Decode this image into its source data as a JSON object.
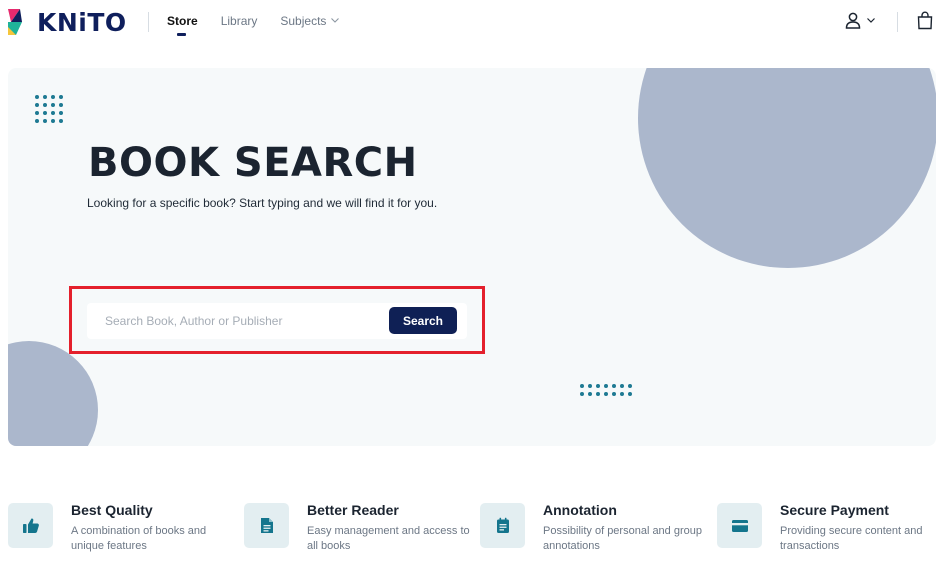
{
  "brand": {
    "name": "KNiTO",
    "colors": {
      "navy": "#0f1f5c",
      "teal": "#1e7a93",
      "pink": "#e62a6e",
      "yellow": "#f5c63b",
      "green": "#1fb39a"
    }
  },
  "nav": {
    "items": [
      {
        "label": "Store",
        "active": true
      },
      {
        "label": "Library",
        "active": false
      },
      {
        "label": "Subjects",
        "active": false,
        "has_dropdown": true
      }
    ]
  },
  "header_icons": {
    "user": "user-icon",
    "user_menu": "chevron-down-icon",
    "cart": "shopping-bag-icon"
  },
  "hero": {
    "title": "BOOK SEARCH",
    "subtitle": "Looking for a specific book? Start typing and we will find it for you.",
    "search": {
      "placeholder": "Search Book, Author or Publisher",
      "value": "",
      "button_label": "Search"
    }
  },
  "features": [
    {
      "icon": "thumbs-up-icon",
      "title": "Best Quality",
      "description": "A combination of books and unique features"
    },
    {
      "icon": "document-icon",
      "title": "Better Reader",
      "description": "Easy management and access to all books"
    },
    {
      "icon": "notepad-icon",
      "title": "Annotation",
      "description": "Possibility of personal and group annotations"
    },
    {
      "icon": "credit-card-icon",
      "title": "Secure Payment",
      "description": "Providing secure content and transactions"
    }
  ]
}
